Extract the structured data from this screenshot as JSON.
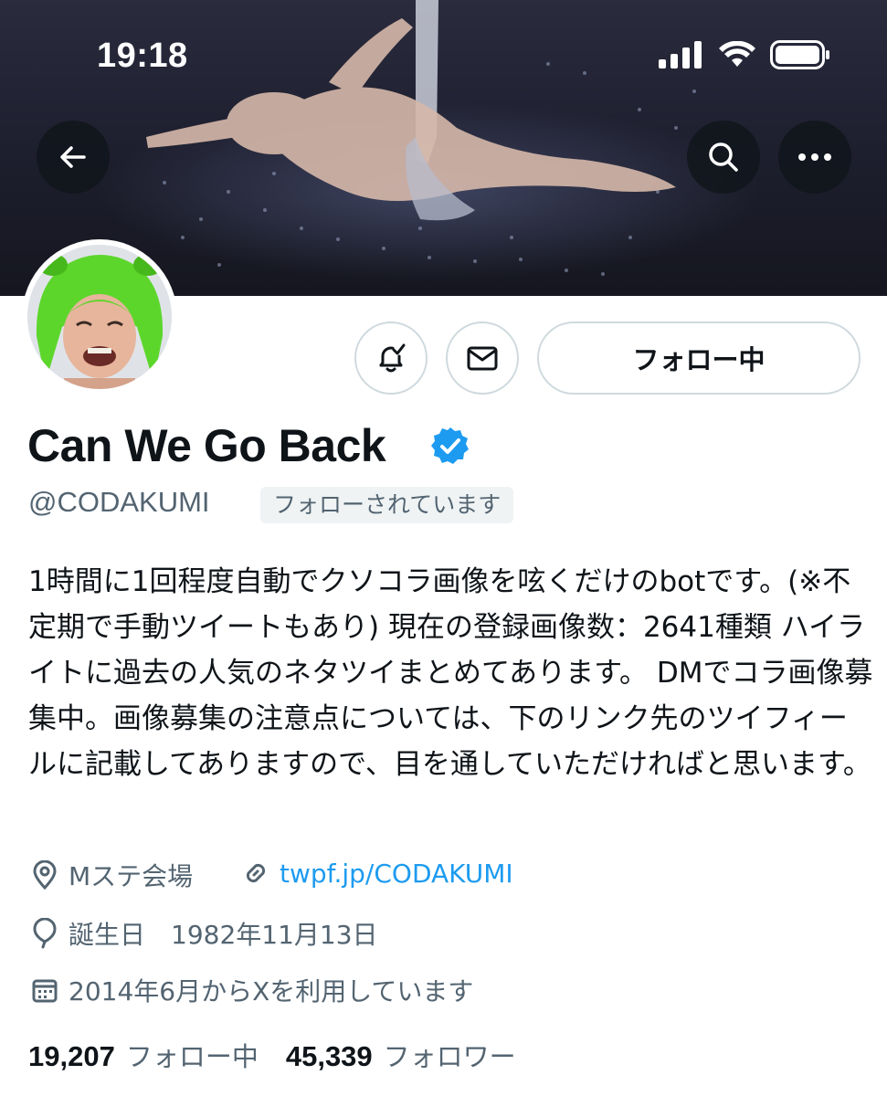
{
  "status_bar": {
    "time": "19:18"
  },
  "header": {
    "back_icon": "arrow-left-icon",
    "search_icon": "search-icon",
    "more_icon": "more-horizontal-icon"
  },
  "profile": {
    "display_name": "Can We Go Back",
    "handle": "@CODAKUMI",
    "follows_you_badge": "フォローされています",
    "verified": true,
    "bio": "1時間に1回程度自動でクソコラ画像を呟くだけのbotです。(※不定期で手動ツイートもあり) 現在の登録画像数：2641種類 ハイライトに過去の人気のネタツイまとめてあります。 DMでコラ画像募集中。画像募集の注意点については、下のリンク先のツイフィールに記載してありますので、目を通していただければと思います。",
    "location": "Mステ会場",
    "link": "twpf.jp/CODAKUMI",
    "birthday": "誕生日　1982年11月13日",
    "joined": "2014年6月からXを利用しています"
  },
  "actions": {
    "follow_button_label": "フォロー中"
  },
  "stats": {
    "following_count": "19,207",
    "following_label": "フォロー中",
    "followers_count": "45,339",
    "followers_label": "フォロワー"
  },
  "colors": {
    "accent": "#1d9bf0",
    "text_primary": "#0f1419",
    "text_secondary": "#536471",
    "border": "#cfd9de"
  }
}
